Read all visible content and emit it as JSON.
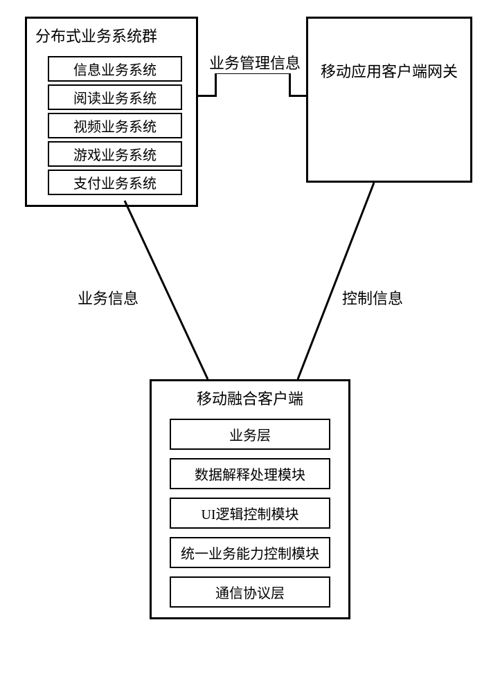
{
  "top_left": {
    "title": "分布式业务系统群",
    "items": [
      "信息业务系统",
      "阅读业务系统",
      "视频业务系统",
      "游戏业务系统",
      "支付业务系统"
    ]
  },
  "top_right": {
    "text": "移动应用客户端网关"
  },
  "bottom": {
    "title": "移动融合客户端",
    "items": [
      "业务层",
      "数据解释处理模块",
      "UI逻辑控制模块",
      "统一业务能力控制模块",
      "通信协议层"
    ]
  },
  "edges": {
    "top_link": "业务管理信息",
    "left_diag": "业务信息",
    "right_diag": "控制信息"
  }
}
